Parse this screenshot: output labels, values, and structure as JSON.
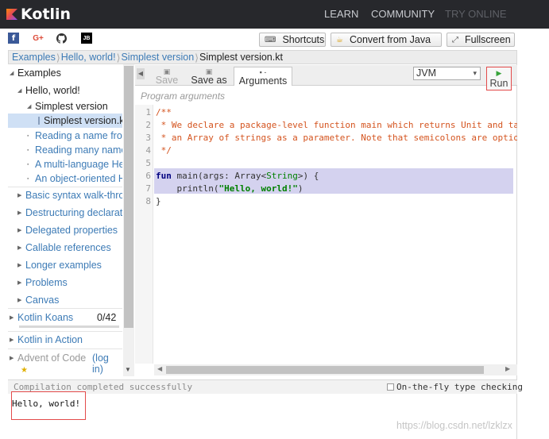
{
  "topbar": {
    "logo_text": "Kotlin",
    "nav": [
      "LEARN",
      "COMMUNITY",
      "TRY ONLINE"
    ]
  },
  "social": {
    "facebook": "f",
    "gplus": "G+",
    "github": "github-icon",
    "jetbrains": "JB"
  },
  "toolbar": {
    "shortcuts": "Shortcuts",
    "convert": "Convert from Java",
    "fullscreen": "Fullscreen"
  },
  "breadcrumb": [
    "Examples",
    "Hello, world!",
    "Simplest version",
    "Simplest version.kt"
  ],
  "sidebar": {
    "items": [
      {
        "label": "Examples"
      },
      {
        "label": "Hello, world!"
      },
      {
        "label": "Simplest version"
      },
      {
        "label": "Simplest version.kt"
      },
      {
        "label": "Reading a name from the command line"
      },
      {
        "label": "Reading many names from the command line"
      },
      {
        "label": "A multi-language Hello"
      },
      {
        "label": "An object-oriented Hello"
      },
      {
        "label": "Basic syntax walk-through"
      },
      {
        "label": "Destructuring declarations"
      },
      {
        "label": "Delegated properties"
      },
      {
        "label": "Callable references"
      },
      {
        "label": "Longer examples"
      },
      {
        "label": "Problems"
      },
      {
        "label": "Canvas"
      },
      {
        "label": "Kotlin Koans"
      },
      {
        "label": "Kotlin in Action"
      },
      {
        "label": "Advent of Code"
      }
    ],
    "koans_progress": "0/42",
    "koans_progress_fraction": 0,
    "login_link": "(log in)",
    "star": "★"
  },
  "editor": {
    "save": "Save",
    "save_as": "Save as",
    "arguments": "Arguments",
    "run": "Run",
    "platform": "JVM",
    "program_arguments_placeholder": "Program arguments",
    "line_numbers": [
      "1",
      "2",
      "3",
      "4",
      "5",
      "6",
      "7",
      "8"
    ],
    "code": {
      "l1": "/**",
      "l2": " * We declare a package-level function main which returns Unit and ta",
      "l3": " * an Array of strings as a parameter. Note that semicolons are optio",
      "l4": " */",
      "l6_kw": "fun",
      "l6_a": " main(args: Array<",
      "l6_type": "String",
      "l6_b": ">) {",
      "l7_a": "    println(",
      "l7_str": "\"Hello, world!\"",
      "l7_b": ")",
      "l8": "}"
    }
  },
  "console": {
    "status": "Compilation completed successfully",
    "on_the_fly": "On-the-fly type checking",
    "output": "Hello, world!"
  },
  "watermark": "https://blog.csdn.net/lzklzx"
}
